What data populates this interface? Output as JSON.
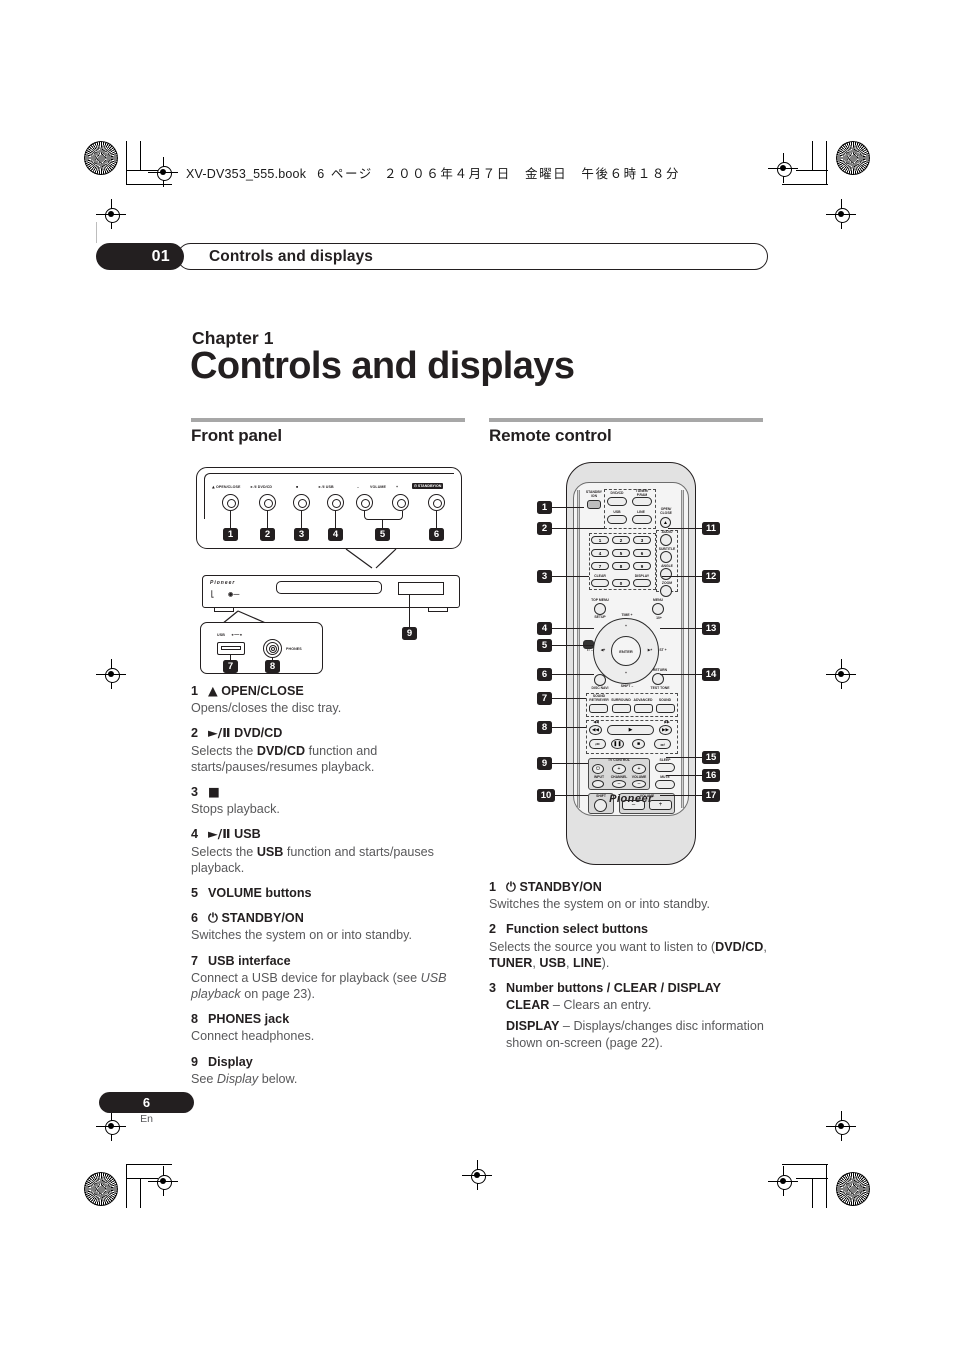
{
  "book_header": {
    "filename": "XV-DV353_555.book",
    "page_marker": "6 ページ",
    "date": "２００６年４月７日　金曜日　午後６時１８分"
  },
  "running_head": {
    "chapter_number": "01",
    "title": "Controls and displays"
  },
  "chapter": {
    "label": "Chapter 1",
    "title": "Controls and displays"
  },
  "sections": {
    "front_panel": {
      "heading": "Front panel"
    },
    "remote_control": {
      "heading": "Remote control"
    }
  },
  "front_panel_diagram": {
    "button_labels": [
      "OPEN/CLOSE",
      "DVD/CD",
      "",
      "USB",
      "VOLUME",
      "STANDBY/ON"
    ],
    "volume_minus": "–",
    "volume_plus": "+",
    "usb_detail_label": "USB",
    "phones_detail_label": "PHONES",
    "brand": "Pioneer",
    "callouts": [
      "1",
      "2",
      "3",
      "4",
      "5",
      "6",
      "7",
      "8",
      "9"
    ]
  },
  "remote_diagram": {
    "brand": "Pioneer",
    "callouts": [
      "1",
      "2",
      "3",
      "4",
      "5",
      "6",
      "7",
      "8",
      "9",
      "10",
      "11",
      "12",
      "13",
      "14",
      "15",
      "16",
      "17"
    ],
    "buttons": {
      "standby": "STANDBY/ON",
      "dvdcd": "DVD/CD",
      "tuner": "TUNER/P.RAM",
      "usb": "USB",
      "line": "LINE",
      "open_close": "OPEN/CLOSE",
      "audio": "AUDIO",
      "subtitle": "SUBTITLE",
      "angle": "ANGLE",
      "zoom": "ZOOM",
      "clear": "CLEAR",
      "display": "DISPLAY",
      "top_menu": "TOP MENU",
      "setup": "SETUP",
      "menu": "MENU",
      "ten_plus": "10+",
      "time": "TIME +",
      "shift_minus": "SHIFT –",
      "it_minus": "IT –",
      "st_plus": "ST +",
      "enter": "ENTER",
      "disc_navigator": "DISC NAVI",
      "return": "RETURN",
      "test_tone": "TEST TONE",
      "sound_retriever": "SOUND RETRIEVER",
      "surround": "SURROUND",
      "advanced": "ADVANCED",
      "sound": "SOUND",
      "tv_control": "TV CONTROL",
      "input": "INPUT",
      "channel": "CHANNEL",
      "tv_volume": "VOLUME",
      "shift": "SHIFT",
      "volume": "VOLUME",
      "volume_minus": "–",
      "volume_plus": "+",
      "sleep": "SLEEP",
      "mute": "MUTE",
      "numbers": [
        "1",
        "2",
        "3",
        "4",
        "5",
        "6",
        "7",
        "8",
        "9",
        "0"
      ]
    }
  },
  "front_panel_items": [
    {
      "n": "1",
      "glyph": "▲",
      "title": "OPEN/CLOSE",
      "body": "Opens/closes the disc tray."
    },
    {
      "n": "2",
      "glyph": "►/Ⅱ",
      "title": "DVD/CD",
      "body_pre": "Selects the ",
      "body_bold": "DVD/CD",
      "body_post": " function and starts/pauses/resumes playback."
    },
    {
      "n": "3",
      "glyph": "■",
      "title": "",
      "body": "Stops playback."
    },
    {
      "n": "4",
      "glyph": "►/Ⅱ",
      "title": "USB",
      "body_pre": "Selects the ",
      "body_bold": "USB",
      "body_post": " function and starts/pauses playback."
    },
    {
      "n": "5",
      "glyph": "",
      "title": "VOLUME buttons",
      "body": ""
    },
    {
      "n": "6",
      "glyph": "⏻",
      "title": "STANDBY/ON",
      "body": "Switches the system on or into standby."
    },
    {
      "n": "7",
      "glyph": "",
      "title": "USB interface",
      "body_pre": "Connect a USB device for playback (see ",
      "body_italic": "USB playback",
      "body_post": " on page 23)."
    },
    {
      "n": "8",
      "glyph": "",
      "title": "PHONES jack",
      "body": "Connect headphones."
    },
    {
      "n": "9",
      "glyph": "",
      "title": "Display",
      "body_pre": "See ",
      "body_italic": "Display",
      "body_post": " below."
    }
  ],
  "remote_items": [
    {
      "n": "1",
      "glyph": "⏻",
      "title": "STANDBY/ON",
      "body": "Switches the system on or into standby."
    },
    {
      "n": "2",
      "glyph": "",
      "title": "Function select buttons",
      "body_pre": "Selects the source you want to listen to (",
      "inline_bold": [
        "DVD/CD",
        "TUNER",
        "USB",
        "LINE"
      ],
      "body_post": ")."
    },
    {
      "n": "3",
      "glyph": "",
      "title": "Number buttons / CLEAR / DISPLAY",
      "sub": [
        {
          "bold": "CLEAR",
          "text": " – Clears an entry."
        },
        {
          "bold": "DISPLAY",
          "text": " – Displays/changes disc information shown on-screen (page 22)."
        }
      ]
    }
  ],
  "footer": {
    "page_number": "6",
    "language": "En"
  },
  "colors": {
    "ink": "#231f20",
    "body_text": "#58585a",
    "rule": "#a7a7a7",
    "remote_shell": "#e2e2e2"
  }
}
